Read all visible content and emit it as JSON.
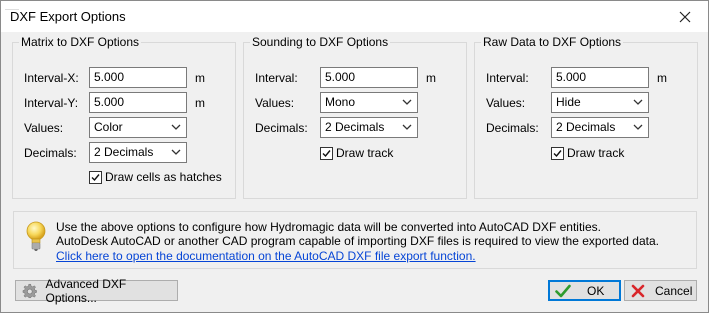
{
  "window": {
    "title": "DXF Export Options",
    "close_icon": "close-icon"
  },
  "matrix": {
    "legend": "Matrix to DXF Options",
    "interval_x_label": "Interval-X:",
    "interval_x_value": "5.000",
    "interval_x_unit": "m",
    "interval_y_label": "Interval-Y:",
    "interval_y_value": "5.000",
    "interval_y_unit": "m",
    "values_label": "Values:",
    "values_selected": "Color",
    "decimals_label": "Decimals:",
    "decimals_selected": "2 Decimals",
    "hatches_label": "Draw cells as hatches",
    "hatches_checked": true
  },
  "sounding": {
    "legend": "Sounding to DXF Options",
    "interval_label": "Interval:",
    "interval_value": "5.000",
    "interval_unit": "m",
    "values_label": "Values:",
    "values_selected": "Mono",
    "decimals_label": "Decimals:",
    "decimals_selected": "2 Decimals",
    "track_label": "Draw track",
    "track_checked": true
  },
  "raw": {
    "legend": "Raw Data to DXF Options",
    "interval_label": "Interval:",
    "interval_value": "5.000",
    "interval_unit": "m",
    "values_label": "Values:",
    "values_selected": "Hide",
    "decimals_label": "Decimals:",
    "decimals_selected": "2 Decimals",
    "track_label": "Draw track",
    "track_checked": true
  },
  "info": {
    "icon": "lightbulb-icon",
    "line1": "Use the above options to configure how Hydromagic data will be converted into AutoCAD DXF entities.",
    "line2": "AutoDesk AutoCAD or another CAD program capable of importing DXF files is required to view the exported data.",
    "link": "Click here to open the documentation on the AutoCAD DXF file export function."
  },
  "buttons": {
    "advanced_label": "Advanced DXF Options...",
    "ok_label": "OK",
    "cancel_label": "Cancel"
  },
  "colors": {
    "ok_check": "#2e9b2e",
    "cancel_x": "#d9262a",
    "link": "#0645d6",
    "default_button_border": "#0078d7"
  }
}
